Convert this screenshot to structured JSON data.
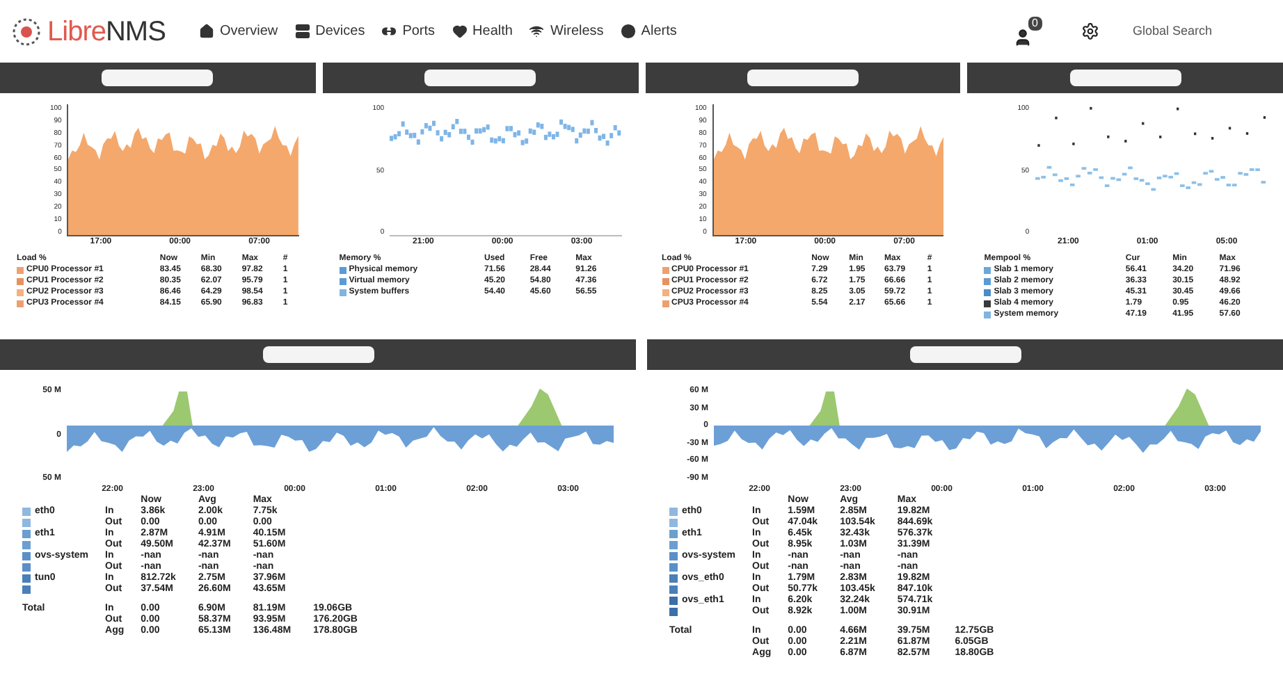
{
  "navbar": {
    "logo_red": "Libre",
    "logo_dark": "NMS",
    "menu": [
      {
        "label": "Overview"
      },
      {
        "label": "Devices"
      },
      {
        "label": "Ports"
      },
      {
        "label": "Health"
      },
      {
        "label": "Wireless"
      },
      {
        "label": "Alerts"
      }
    ],
    "notifications": "0",
    "search": {
      "placeholder": "Global Search"
    }
  },
  "top_widgets": [
    {
      "kind": "area",
      "y_labels": [
        "100",
        "90",
        "80",
        "70",
        "60",
        "50",
        "40",
        "30",
        "20",
        "10",
        "0"
      ],
      "x_labels": [
        "17:00",
        "00:00",
        "07:00"
      ],
      "legend_header": [
        "Load %",
        "Now",
        "Min",
        "Max",
        "#"
      ],
      "legend_rows": [
        {
          "color": "#f0a070",
          "cells": [
            "CPU0 Processor #1",
            "83.45",
            "68.30",
            "97.82",
            "1"
          ]
        },
        {
          "color": "#e89060",
          "cells": [
            "CPU1 Processor #2",
            "80.35",
            "62.07",
            "95.79",
            "1"
          ]
        },
        {
          "color": "#f4b080",
          "cells": [
            "CPU2 Processor #3",
            "86.46",
            "64.29",
            "98.54",
            "1"
          ]
        },
        {
          "color": "#eca070",
          "cells": [
            "CPU3 Processor #4",
            "84.15",
            "65.90",
            "96.83",
            "1"
          ]
        }
      ]
    },
    {
      "kind": "line",
      "y_labels": [
        "100",
        "50",
        "0"
      ],
      "x_labels": [
        "21:00",
        "00:00",
        "03:00"
      ],
      "legend_header": [
        "Memory %",
        "Used",
        "Free",
        "Max"
      ],
      "legend_rows": [
        {
          "color": "#5b9bd5",
          "cells": [
            "Physical memory",
            "71.56",
            "28.44",
            "91.26"
          ]
        },
        {
          "color": "#5b9bd5",
          "cells": [
            "Virtual memory",
            "45.20",
            "54.80",
            "47.36"
          ]
        },
        {
          "color": "#7fb5e0",
          "cells": [
            "System buffers",
            "54.40",
            "45.60",
            "56.55"
          ]
        }
      ]
    },
    {
      "kind": "area",
      "y_labels": [
        "100",
        "90",
        "80",
        "70",
        "60",
        "50",
        "40",
        "30",
        "20",
        "10",
        "0"
      ],
      "x_labels": [
        "17:00",
        "00:00",
        "07:00"
      ],
      "legend_header": [
        "Load %",
        "Now",
        "Min",
        "Max",
        "#"
      ],
      "legend_rows": [
        {
          "color": "#f0a070",
          "cells": [
            "CPU0 Processor #1",
            "7.29",
            "1.95",
            "63.79",
            "1"
          ]
        },
        {
          "color": "#e89060",
          "cells": [
            "CPU1 Processor #2",
            "6.72",
            "1.75",
            "66.66",
            "1"
          ]
        },
        {
          "color": "#f4b080",
          "cells": [
            "CPU2 Processor #3",
            "8.25",
            "3.05",
            "59.72",
            "1"
          ]
        },
        {
          "color": "#eca070",
          "cells": [
            "CPU3 Processor #4",
            "5.54",
            "2.17",
            "65.66",
            "1"
          ]
        }
      ]
    },
    {
      "kind": "scatter",
      "y_labels": [
        "100",
        "50",
        "0"
      ],
      "x_labels": [
        "21:00",
        "01:00",
        "05:00"
      ],
      "legend_header": [
        "Mempool %",
        "Cur",
        "Min",
        "Max"
      ],
      "legend_rows": [
        {
          "color": "#6aa8d8",
          "cells": [
            "Slab 1 memory",
            "56.41",
            "34.20",
            "71.96"
          ]
        },
        {
          "color": "#5b9bd5",
          "cells": [
            "Slab 2 memory",
            "36.33",
            "30.15",
            "48.92"
          ]
        },
        {
          "color": "#4a8cc8",
          "cells": [
            "Slab 3 memory",
            "45.31",
            "30.45",
            "49.66"
          ]
        },
        {
          "color": "#3a3a3a",
          "cells": [
            "Slab 4 memory",
            "1.79",
            "0.95",
            "46.20"
          ]
        },
        {
          "color": "#7fb5e0",
          "cells": [
            "System memory",
            "47.19",
            "41.95",
            "57.60"
          ]
        }
      ]
    }
  ],
  "bottom_widgets": [
    {
      "y_labels": [
        "50 M",
        "0",
        "50 M"
      ],
      "x_labels": [
        "22:00",
        "23:00",
        "00:00",
        "01:00",
        "02:00",
        "03:00"
      ],
      "columns": [
        "Now",
        "Avg",
        "Max"
      ],
      "interfaces": [
        {
          "name": "eth0",
          "color": "#8fb8e0",
          "rows": [
            {
              "dir": "In",
              "now": "3.86k",
              "avg": "2.00k",
              "max": "7.75k"
            },
            {
              "dir": "Out",
              "now": "0.00",
              "avg": "0.00",
              "max": "0.00"
            }
          ]
        },
        {
          "name": "eth1",
          "color": "#6a9fd0",
          "rows": [
            {
              "dir": "In",
              "now": "2.87M",
              "avg": "4.91M",
              "max": "40.15M"
            },
            {
              "dir": "Out",
              "now": "49.50M",
              "avg": "42.37M",
              "max": "51.60M"
            }
          ]
        },
        {
          "name": "ovs-system",
          "color": "#5b8fc8",
          "rows": [
            {
              "dir": "In",
              "now": "-nan",
              "avg": "-nan",
              "max": "-nan"
            },
            {
              "dir": "Out",
              "now": "-nan",
              "avg": "-nan",
              "max": "-nan"
            }
          ]
        },
        {
          "name": "tun0",
          "color": "#4a7fb8",
          "rows": [
            {
              "dir": "In",
              "now": "812.72k",
              "avg": "2.75M",
              "max": "37.96M"
            },
            {
              "dir": "Out",
              "now": "37.54M",
              "avg": "26.60M",
              "max": "43.65M"
            }
          ]
        }
      ],
      "totals": [
        {
          "label": "Total",
          "dir": "In",
          "now": "0.00",
          "avg": "6.90M",
          "max": "81.19M",
          "total": "19.06GB"
        },
        {
          "dir": "Out",
          "now": "0.00",
          "avg": "58.37M",
          "max": "93.95M",
          "total": "176.20GB"
        },
        {
          "dir": "Agg",
          "now": "0.00",
          "avg": "65.13M",
          "max": "136.48M",
          "total": "178.80GB"
        }
      ]
    },
    {
      "y_labels": [
        "60 M",
        "30 M",
        "0",
        "-30 M",
        "-60 M",
        "-90 M"
      ],
      "x_labels": [
        "22:00",
        "23:00",
        "00:00",
        "01:00",
        "02:00",
        "03:00"
      ],
      "columns": [
        "Now",
        "Avg",
        "Max"
      ],
      "interfaces": [
        {
          "name": "eth0",
          "color": "#8fb8e0",
          "rows": [
            {
              "dir": "In",
              "now": "1.59M",
              "avg": "2.85M",
              "max": "19.82M"
            },
            {
              "dir": "Out",
              "now": "47.04k",
              "avg": "103.54k",
              "max": "844.69k"
            }
          ]
        },
        {
          "name": "eth1",
          "color": "#6a9fd0",
          "rows": [
            {
              "dir": "In",
              "now": "6.45k",
              "avg": "32.43k",
              "max": "576.37k"
            },
            {
              "dir": "Out",
              "now": "8.95k",
              "avg": "1.03M",
              "max": "31.39M"
            }
          ]
        },
        {
          "name": "ovs-system",
          "color": "#5b8fc8",
          "rows": [
            {
              "dir": "In",
              "now": "-nan",
              "avg": "-nan",
              "max": "-nan"
            },
            {
              "dir": "Out",
              "now": "-nan",
              "avg": "-nan",
              "max": "-nan"
            }
          ]
        },
        {
          "name": "ovs_eth0",
          "color": "#4a7fb8",
          "rows": [
            {
              "dir": "In",
              "now": "1.79M",
              "avg": "2.83M",
              "max": "19.82M"
            },
            {
              "dir": "Out",
              "now": "50.77k",
              "avg": "103.45k",
              "max": "847.10k"
            }
          ]
        },
        {
          "name": "ovs_eth1",
          "color": "#3a6fa8",
          "rows": [
            {
              "dir": "In",
              "now": "6.20k",
              "avg": "32.24k",
              "max": "574.71k"
            },
            {
              "dir": "Out",
              "now": "8.92k",
              "avg": "1.00M",
              "max": "30.91M"
            }
          ]
        }
      ],
      "totals": [
        {
          "label": "Total",
          "dir": "In",
          "now": "0.00",
          "avg": "4.66M",
          "max": "39.75M",
          "total": "12.75GB"
        },
        {
          "dir": "Out",
          "now": "0.00",
          "avg": "2.21M",
          "max": "61.87M",
          "total": "6.05GB"
        },
        {
          "dir": "Agg",
          "now": "0.00",
          "avg": "6.87M",
          "max": "82.57M",
          "total": "18.80GB"
        }
      ]
    }
  ]
}
